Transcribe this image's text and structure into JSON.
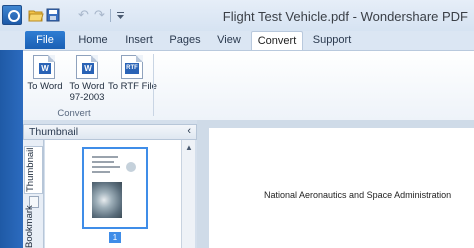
{
  "window": {
    "title": "Flight Test Vehicle.pdf - Wondershare PDF"
  },
  "quick_access": {
    "icons": [
      "app-logo-icon",
      "open-folder-icon",
      "save-icon",
      "undo-icon",
      "redo-icon",
      "customize-toolbar-icon"
    ],
    "undo_glyph": "↶",
    "redo_glyph": "↷"
  },
  "tabs": [
    {
      "label": "File"
    },
    {
      "label": "Home"
    },
    {
      "label": "Insert"
    },
    {
      "label": "Pages"
    },
    {
      "label": "View"
    },
    {
      "label": "Convert",
      "active": true
    },
    {
      "label": "Support"
    }
  ],
  "ribbon": {
    "group_label": "Convert",
    "buttons": [
      {
        "label": "To Word",
        "badge": "W",
        "icon": "word-doc-icon"
      },
      {
        "label_line1": "To Word",
        "label_line2": "97-2003",
        "badge": "W",
        "icon": "word-97-doc-icon"
      },
      {
        "label": "To RTF File",
        "badge": "RTF",
        "icon": "rtf-doc-icon"
      }
    ]
  },
  "thumbnail_panel": {
    "title": "Thumbnail",
    "collapse_glyph": "‹",
    "side_tabs": [
      "Thumbnail",
      "Bookmark"
    ],
    "page_number": "1"
  },
  "document": {
    "text": "National Aeronautics and Space Administration"
  },
  "colors": {
    "accent": "#1a5fb4",
    "selection": "#3f8de8"
  }
}
